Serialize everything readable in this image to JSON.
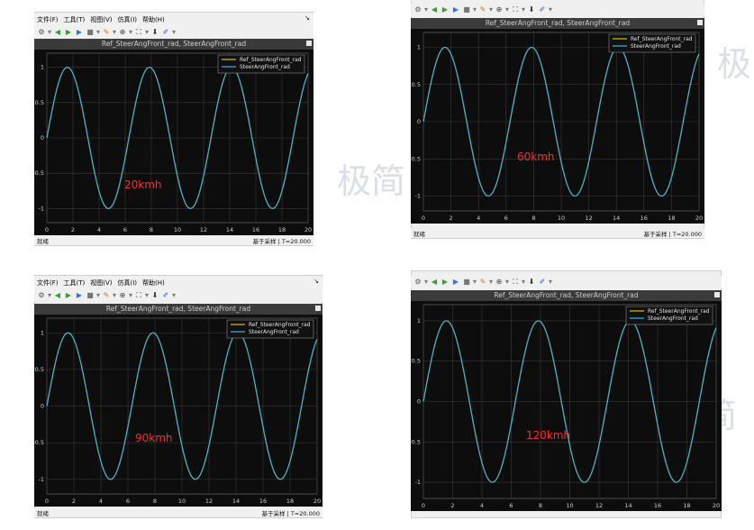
{
  "menu": [
    "文件(F)",
    "工具(T)",
    "视图(V)",
    "仿真(I)",
    "帮助(H)"
  ],
  "status": {
    "left": "就绪",
    "mode": "基于采样",
    "time": "T=20.000"
  },
  "chart_data": [
    {
      "type": "line",
      "title": "Ref_SteerAngFront_rad, SteerAngFront_rad",
      "annotation": "20kmh",
      "series": [
        {
          "name": "Ref_SteerAngFront_rad",
          "color": "#d9c800",
          "function": "sin(t)"
        },
        {
          "name": "SteerAngFront_rad",
          "color": "#3cb4e6",
          "function": "sin(t)"
        }
      ],
      "x": {
        "range": [
          0,
          20
        ],
        "ticks": [
          "0",
          "2",
          "4",
          "6",
          "8",
          "10",
          "12",
          "14",
          "16",
          "18",
          "20"
        ]
      },
      "y": {
        "range": [
          -1.2,
          1.2
        ],
        "ticks": [
          "1",
          "0.5",
          "0",
          "-0.5",
          "-1"
        ]
      },
      "grid": true,
      "legend": "top-right"
    },
    {
      "type": "line",
      "title": "Ref_SteerAngFront_rad, SteerAngFront_rad",
      "annotation": "60kmh",
      "series": [
        {
          "name": "Ref_SteerAngFront_rad",
          "color": "#d9c800",
          "function": "sin(t)"
        },
        {
          "name": "SteerAngFront_rad",
          "color": "#3cb4e6",
          "function": "sin(t)"
        }
      ],
      "x": {
        "range": [
          0,
          20
        ],
        "ticks": [
          "0",
          "2",
          "4",
          "6",
          "8",
          "10",
          "12",
          "14",
          "16",
          "18",
          "20"
        ]
      },
      "y": {
        "range": [
          -1.2,
          1.2
        ],
        "ticks": [
          "1",
          "0.5",
          "0",
          "-0.5",
          "-1"
        ]
      },
      "grid": true,
      "legend": "top-right"
    },
    {
      "type": "line",
      "title": "Ref_SteerAngFront_rad, SteerAngFront_rad",
      "annotation": "90kmh",
      "series": [
        {
          "name": "Ref_SteerAngFront_rad",
          "color": "#d9c800",
          "function": "sin(t)"
        },
        {
          "name": "SteerAngFront_rad",
          "color": "#3cb4e6",
          "function": "sin(t)"
        }
      ],
      "x": {
        "range": [
          0,
          20
        ],
        "ticks": [
          "0",
          "2",
          "4",
          "6",
          "8",
          "10",
          "12",
          "14",
          "16",
          "18",
          "20"
        ]
      },
      "y": {
        "range": [
          -1.2,
          1.2
        ],
        "ticks": [
          "1",
          "0.5",
          "0",
          "-0.5",
          "-1"
        ]
      },
      "grid": true,
      "legend": "top-right"
    },
    {
      "type": "line",
      "title": "Ref_SteerAngFront_rad, SteerAngFront_rad",
      "annotation": "120kmh",
      "series": [
        {
          "name": "Ref_SteerAngFront_rad",
          "color": "#d9c800",
          "function": "sin(t)"
        },
        {
          "name": "SteerAngFront_rad",
          "color": "#3cb4e6",
          "function": "sin(t)"
        }
      ],
      "x": {
        "range": [
          0,
          20
        ],
        "ticks": [
          "0",
          "2",
          "4",
          "6",
          "8",
          "10",
          "12",
          "14",
          "16",
          "18",
          "20"
        ]
      },
      "y": {
        "range": [
          -1.2,
          1.2
        ],
        "ticks": [
          "1",
          "0.5",
          "0",
          "-0.5",
          "-1"
        ]
      },
      "grid": true,
      "legend": "top-right"
    }
  ],
  "watermark": [
    "极",
    "极简",
    "简"
  ],
  "icons": [
    "settings-icon",
    "step-back-icon",
    "run-icon",
    "step-forward-icon",
    "stop-icon",
    "highlight-icon",
    "zoom-icon",
    "fit-to-view-icon",
    "trigger-icon",
    "style-icon"
  ]
}
